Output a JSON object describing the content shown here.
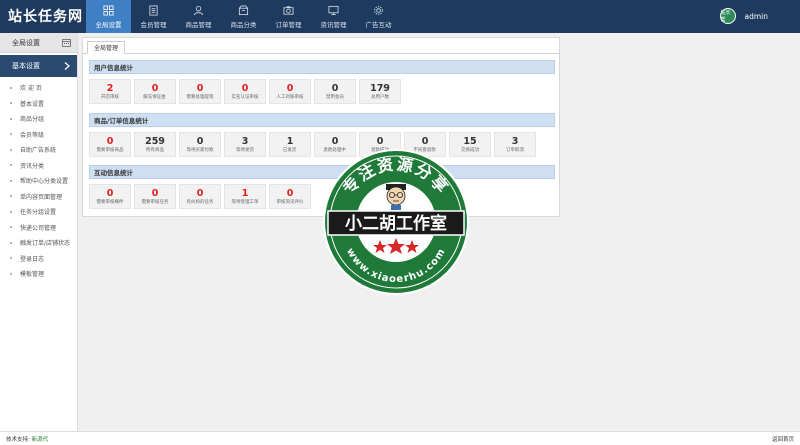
{
  "app": {
    "logo": "站长任务网"
  },
  "nav": [
    {
      "label": "全局设置",
      "icon": "grid-icon",
      "active": true
    },
    {
      "label": "会员管理",
      "icon": "document-icon",
      "active": false
    },
    {
      "label": "商品管理",
      "icon": "user-icon",
      "active": false
    },
    {
      "label": "商品分类",
      "icon": "box-icon",
      "active": false
    },
    {
      "label": "订单管理",
      "icon": "camera-icon",
      "active": false
    },
    {
      "label": "资讯管理",
      "icon": "monitor-icon",
      "active": false
    },
    {
      "label": "广告互动",
      "icon": "gear-icon",
      "active": false
    }
  ],
  "user": {
    "avatar_text": "站长帮",
    "name": "admin"
  },
  "sidebar": {
    "header": "全局设置",
    "section": "基本设置",
    "items": [
      "欢 迎 页",
      "基本设置",
      "商品分组",
      "会员等级",
      "自助广告系统",
      "资讯分类",
      "帮助中心分类设置",
      "单内容页面管理",
      "任务分组设置",
      "快递公司管理",
      "触发订单/店铺状态",
      "登录日志",
      "模板管理"
    ]
  },
  "main": {
    "tab": "全局管理",
    "sections": [
      {
        "title": "用户信息统计",
        "cards": [
          {
            "num": "2",
            "label": "开店审核",
            "color": "#e02020"
          },
          {
            "num": "0",
            "label": "解冻保证金",
            "color": "#e02020"
          },
          {
            "num": "0",
            "label": "需要处理提现",
            "color": "#e02020"
          },
          {
            "num": "0",
            "label": "实名认证审核",
            "color": "#e02020"
          },
          {
            "num": "0",
            "label": "人工对账审核",
            "color": "#e02020"
          },
          {
            "num": "0",
            "label": "禁用会员",
            "color": "#333333"
          },
          {
            "num": "179",
            "label": "总用户数",
            "color": "#333333"
          }
        ]
      },
      {
        "title": "商品/订单信息统计",
        "cards": [
          {
            "num": "0",
            "label": "需要审核商品",
            "color": "#e02020"
          },
          {
            "num": "259",
            "label": "所有商品",
            "color": "#333333"
          },
          {
            "num": "0",
            "label": "等待买家付款",
            "color": "#333333"
          },
          {
            "num": "3",
            "label": "等待发货",
            "color": "#333333"
          },
          {
            "num": "1",
            "label": "已发货",
            "color": "#333333"
          },
          {
            "num": "0",
            "label": "退款处理中",
            "color": "#333333"
          },
          {
            "num": "0",
            "label": "退款成功",
            "color": "#333333"
          },
          {
            "num": "0",
            "label": "不同意退款",
            "color": "#333333"
          },
          {
            "num": "15",
            "label": "交易成功",
            "color": "#333333"
          },
          {
            "num": "3",
            "label": "订单取消",
            "color": "#333333"
          }
        ]
      },
      {
        "title": "互动信息统计",
        "cards": [
          {
            "num": "0",
            "label": "需要审核横件",
            "color": "#e02020"
          },
          {
            "num": "0",
            "label": "需要审核任务",
            "color": "#e02020"
          },
          {
            "num": "0",
            "label": "有纠纷的任务",
            "color": "#e02020"
          },
          {
            "num": "1",
            "label": "等待受理工单",
            "color": "#e02020"
          },
          {
            "num": "0",
            "label": "审核资讯评价",
            "color": "#e02020"
          }
        ]
      }
    ]
  },
  "watermark": {
    "top_text": "专注资源分享",
    "middle_text": "小二胡工作室",
    "bottom_text": "www.xiaoerhu.com"
  },
  "footer": {
    "prefix": "技术支持:",
    "link": "新源代",
    "right": "返回首页"
  }
}
